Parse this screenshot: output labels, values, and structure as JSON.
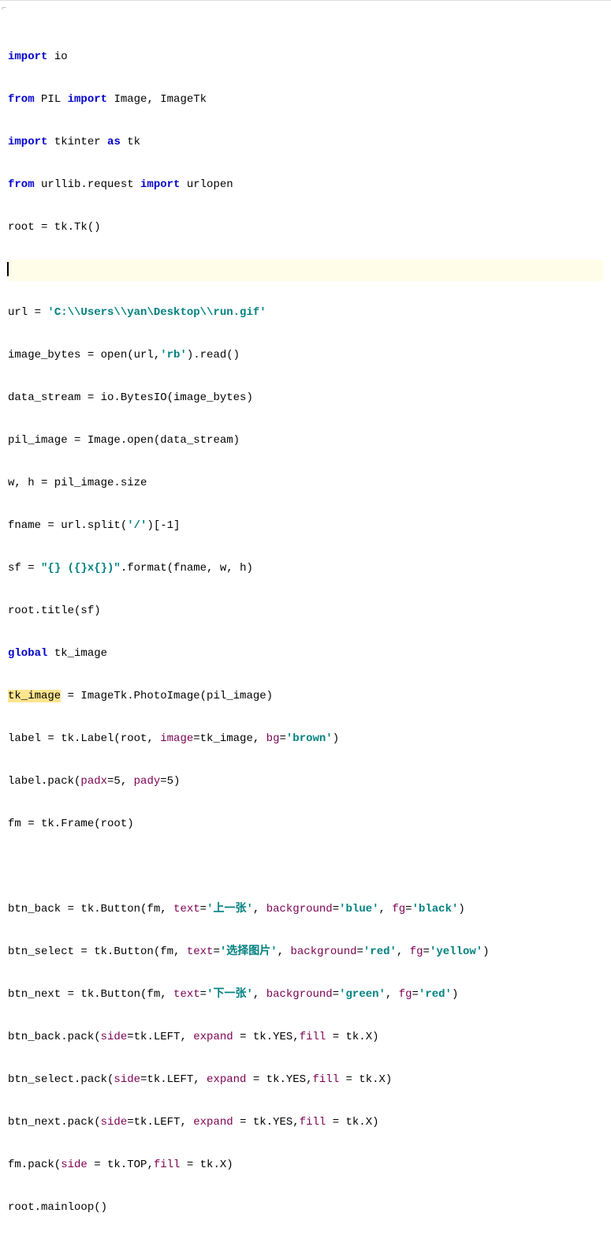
{
  "code": {
    "l1_import": "import",
    "l1_mod": " io",
    "l2_from": "from",
    "l2_pil": " PIL ",
    "l2_import": "import",
    "l2_rest": " Image, ImageTk",
    "l3_import": "import",
    "l3_tk": " tkinter ",
    "l3_as": "as",
    "l3_alias": " tk",
    "l4_from": "from",
    "l4_urllib": " urllib.request ",
    "l4_import": "import",
    "l4_rest": " urlopen",
    "l5": "root = tk.Tk()",
    "l6_blank": "",
    "l7a": "url = ",
    "l7b": "'C:\\\\Users\\\\yan\\Desktop\\\\run.gif'",
    "l8a": "image_bytes = open(url,",
    "l8b": "'rb'",
    "l8c": ").read()",
    "l9": "data_stream = io.BytesIO(image_bytes)",
    "l10": "pil_image = Image.open(data_stream)",
    "l11": "w, h = pil_image.size",
    "l12a": "fname = url.split(",
    "l12b": "'/'",
    "l12c": ")[-1]",
    "l13a": "sf = ",
    "l13b": "\"{} ({}x{})\"",
    "l13c": ".format(fname, w, h)",
    "l14": "root.title(sf)",
    "l15a": "global",
    "l15b": " tk_image",
    "l16a": "tk_image",
    "l16b": " = ImageTk.PhotoImage(pil_image)",
    "l17a": "label = tk.Label(root, ",
    "l17b": "image",
    "l17c": "=tk_image, ",
    "l17d": "bg",
    "l17e": "=",
    "l17f": "'brown'",
    "l17g": ")",
    "l18a": "label.pack(",
    "l18b": "padx",
    "l18c": "=5, ",
    "l18d": "pady",
    "l18e": "=5)",
    "l19": "fm = tk.Frame(root)",
    "l20_blank": "",
    "l21a": "btn_back = tk.Button(fm, ",
    "l21b": "text",
    "l21c": "=",
    "l21d": "'上一张'",
    "l21e": ", ",
    "l21f": "background",
    "l21g": "=",
    "l21h": "'blue'",
    "l21i": ", ",
    "l21j": "fg",
    "l21k": "=",
    "l21l": "'black'",
    "l21m": ")",
    "l22a": "btn_select = tk.Button(fm, ",
    "l22b": "text",
    "l22c": "=",
    "l22d": "'选择图片'",
    "l22e": ", ",
    "l22f": "background",
    "l22g": "=",
    "l22h": "'red'",
    "l22i": ", ",
    "l22j": "fg",
    "l22k": "=",
    "l22l": "'yellow'",
    "l22m": ")",
    "l23a": "btn_next = tk.Button(fm, ",
    "l23b": "text",
    "l23c": "=",
    "l23d": "'下一张'",
    "l23e": ", ",
    "l23f": "background",
    "l23g": "=",
    "l23h": "'green'",
    "l23i": ", ",
    "l23j": "fg",
    "l23k": "=",
    "l23l": "'red'",
    "l23m": ")",
    "l24a": "btn_back.pack(",
    "l24b": "side",
    "l24c": "=tk.LEFT, ",
    "l24d": "expand",
    "l24e": " = tk.YES,",
    "l24f": "fill",
    "l24g": " = tk.X)",
    "l25a": "btn_select.pack(",
    "l25b": "side",
    "l25c": "=tk.LEFT, ",
    "l25d": "expand",
    "l25e": " = tk.YES,",
    "l25f": "fill",
    "l25g": " = tk.X)",
    "l26a": "btn_next.pack(",
    "l26b": "side",
    "l26c": "=tk.LEFT, ",
    "l26d": "expand",
    "l26e": " = tk.YES,",
    "l26f": "fill",
    "l26g": " = tk.X)",
    "l27a": "fm.pack(",
    "l27b": "side",
    "l27c": " = tk.TOP,",
    "l27d": "fill",
    "l27e": " = tk.X)",
    "l28": "root.mainloop()"
  }
}
